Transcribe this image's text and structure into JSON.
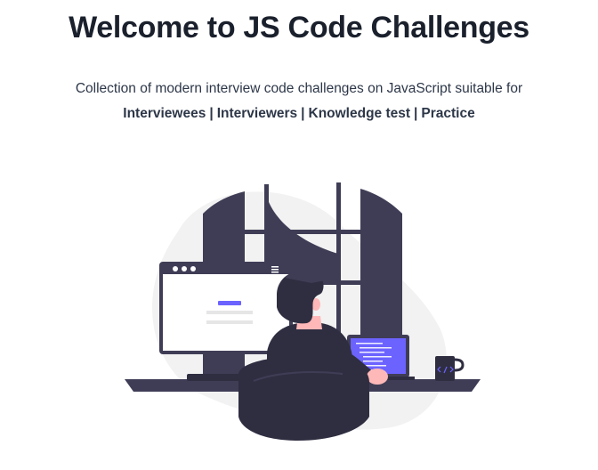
{
  "hero": {
    "title": "Welcome to JS Code Challenges",
    "subtitle": "Collection of modern interview code challenges on JavaScript suitable for",
    "audience": {
      "items": [
        "Interviewees",
        "Interviewers",
        "Knowledge test",
        "Practice"
      ],
      "separator": "|"
    }
  },
  "illustration": {
    "name": "programmer-at-desk",
    "colors": {
      "dark": "#3f3d56",
      "darker": "#2f2e41",
      "accent": "#6c63ff",
      "light_gray": "#f2f2f2",
      "gray": "#e6e6e6",
      "skin": "#ffb8b8",
      "white": "#ffffff"
    }
  }
}
